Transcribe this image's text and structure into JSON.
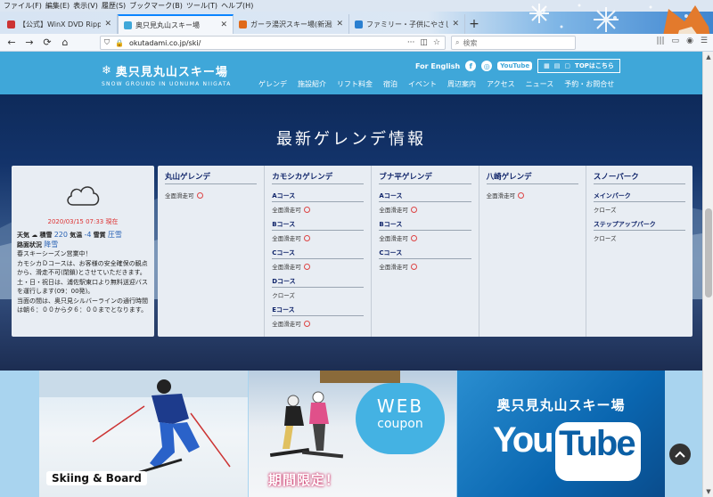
{
  "menubar": [
    "ファイル(F)",
    "編集(E)",
    "表示(V)",
    "履歴(S)",
    "ブックマーク(B)",
    "ツール(T)",
    "ヘルプ(H)"
  ],
  "tabs": [
    {
      "label": "【公式】WinX DVD Ripper Platin",
      "color": "#c33",
      "active": false
    },
    {
      "label": "奥只見丸山スキー場",
      "color": "#3fa7d9",
      "active": true
    },
    {
      "label": "ガーラ湯沢スキー場(新潟県湯沢町",
      "color": "#e06a1a",
      "active": false
    },
    {
      "label": "ファミリー・子供にやさしい群馬の日",
      "color": "#2a7fd0",
      "active": false
    }
  ],
  "nav": {
    "url": "okutadami.co.jp/ski/",
    "search_placeholder": "検索"
  },
  "site": {
    "logo_name": "奥只見丸山スキー場",
    "logo_sub": "SNOW GROUND IN UONUMA NIIGATA",
    "for_english": "For English",
    "top_link": "TOPはこちら",
    "youtube": "YouTube",
    "gnav": [
      "ゲレンデ",
      "施設紹介",
      "リフト料金",
      "宿泊",
      "イベント",
      "周辺案内",
      "アクセス",
      "ニュース",
      "予約・お問合せ"
    ]
  },
  "hero": {
    "title": "最新ゲレンデ情報"
  },
  "weather": {
    "date": "2020/03/15 07:33 現在",
    "label_weather": "天気",
    "weather_icon": "cloud-icon",
    "label_depth": "積雪",
    "depth": "220",
    "label_temp": "気温",
    "temp": "-4",
    "label_quality": "雪質",
    "quality": "圧雪",
    "label_road": "路面状況",
    "road": "降雪",
    "notice": "春スキーシーズン営業中！\nカモシカＤコースは、お客様の安全確保の観点から、滑走不可(閉鎖)とさせていただきます。\n土・日・祝日は、浦佐駅東口より無料送迎バスを運行します(09：00発)。\n当面の間は、奥只見シルバーラインの通行時間は朝６：００から夕６：００までとなります。"
  },
  "areas": [
    {
      "name": "丸山ゲレンデ",
      "courses": [
        {
          "name": "",
          "status": "全面滑走可",
          "open": true
        }
      ]
    },
    {
      "name": "カモシカゲレンデ",
      "courses": [
        {
          "name": "Aコース",
          "status": "全面滑走可",
          "open": true
        },
        {
          "name": "Bコース",
          "status": "全面滑走可",
          "open": true
        },
        {
          "name": "Cコース",
          "status": "全面滑走可",
          "open": true
        },
        {
          "name": "Dコース",
          "status": "クローズ",
          "open": false
        },
        {
          "name": "Eコース",
          "status": "全面滑走可",
          "open": true
        }
      ]
    },
    {
      "name": "ブナ平ゲレンデ",
      "courses": [
        {
          "name": "Aコース",
          "status": "全面滑走可",
          "open": true
        },
        {
          "name": "Bコース",
          "status": "全面滑走可",
          "open": true
        },
        {
          "name": "Cコース",
          "status": "全面滑走可",
          "open": true
        }
      ]
    },
    {
      "name": "八崎ゲレンデ",
      "courses": [
        {
          "name": "",
          "status": "全面滑走可",
          "open": true
        }
      ]
    },
    {
      "name": "スノーパーク",
      "courses": [
        {
          "name": "メインパーク",
          "status": "クローズ",
          "open": false
        },
        {
          "name": "ステップアップパーク",
          "status": "クローズ",
          "open": false
        }
      ]
    }
  ],
  "banners": {
    "ski_label": "Skiing & Board",
    "web": "WEB",
    "coupon": "coupon",
    "kikan": "期間限定！",
    "yt_title": "奥只見丸山スキー場",
    "yt_you": "You",
    "yt_tube": "Tube"
  }
}
